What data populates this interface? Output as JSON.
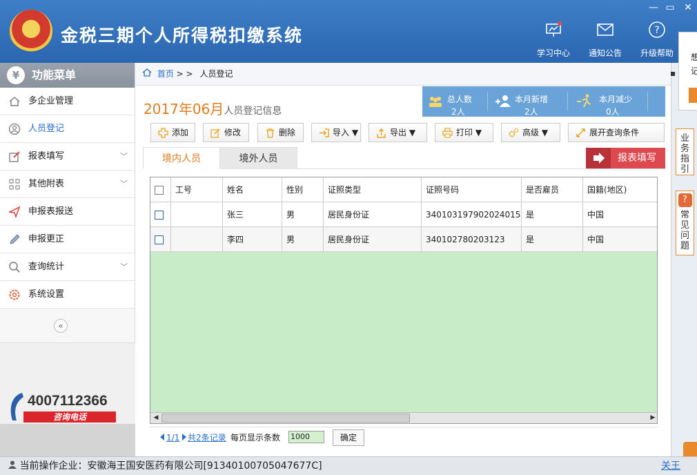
{
  "app": {
    "title": "金税三期个人所得税扣缴系统"
  },
  "window_controls": {
    "minimize": "—",
    "maximize": "▭",
    "close": "✕"
  },
  "top_nav": [
    {
      "label": "学习中心",
      "icon": "study-icon"
    },
    {
      "label": "通知公告",
      "icon": "mail-icon"
    },
    {
      "label": "升级帮助",
      "icon": "help-icon"
    }
  ],
  "sidebar": {
    "header": "功能菜单",
    "header_icon": "¥",
    "items": [
      {
        "label": "多企业管理",
        "icon": "home-icon",
        "expandable": false
      },
      {
        "label": "人员登记",
        "icon": "person-icon",
        "expandable": false,
        "active": true
      },
      {
        "label": "报表填写",
        "icon": "edit-icon",
        "expandable": true
      },
      {
        "label": "其他附表",
        "icon": "grid-icon",
        "expandable": true
      },
      {
        "label": "申报表报送",
        "icon": "send-icon",
        "expandable": false
      },
      {
        "label": "申报更正",
        "icon": "pen-icon",
        "expandable": false
      },
      {
        "label": "查询统计",
        "icon": "search-icon",
        "expandable": true
      },
      {
        "label": "系统设置",
        "icon": "gear-icon",
        "expandable": false
      }
    ],
    "collapse": "«",
    "hotline": {
      "number": "4007112366",
      "label": "咨询电话"
    }
  },
  "breadcrumb": {
    "home": "首页",
    "sep": "> >",
    "current": "人员登记"
  },
  "period": {
    "month": "2017年06月",
    "subtitle": "人员登记信息"
  },
  "stats": [
    {
      "label": "总人数",
      "value": "2人"
    },
    {
      "label": "本月新增",
      "value": "2人"
    },
    {
      "label": "本月减少",
      "value": "0人"
    }
  ],
  "toolbar": {
    "add": "添加",
    "edit": "修改",
    "delete": "删除",
    "import": "导入 ▼",
    "export": "导出 ▼",
    "print": "打印 ▼",
    "advanced": "高级 ▼",
    "expand_query": "展开查询条件"
  },
  "tabs": {
    "domestic": "境内人员",
    "foreign": "境外人员"
  },
  "report_button": "报表填写",
  "table": {
    "columns": [
      "工号",
      "姓名",
      "性别",
      "证照类型",
      "证照号码",
      "是否雇员",
      "国籍(地区)"
    ],
    "rows": [
      {
        "id": "",
        "name": "张三",
        "gender": "男",
        "id_type": "居民身份证",
        "id_number": "340103197902024015",
        "employee": "是",
        "nationality": "中国"
      },
      {
        "id": "",
        "name": "李四",
        "gender": "男",
        "id_type": "居民身份证",
        "id_number": "340102780203123",
        "employee": "是",
        "nationality": "中国"
      }
    ]
  },
  "pager": {
    "page": "1/1",
    "total": "共2条记录",
    "per_page_label": "每页显示条数",
    "per_page_value": "1000",
    "confirm": "确定"
  },
  "rail": {
    "popup_text": "想 记",
    "guide": "业务指引",
    "faq": "常见问题"
  },
  "statusbar": {
    "text": "当前操作企业：安徽海王国安医药有限公司[91340100705047677C]",
    "close": "关王"
  }
}
